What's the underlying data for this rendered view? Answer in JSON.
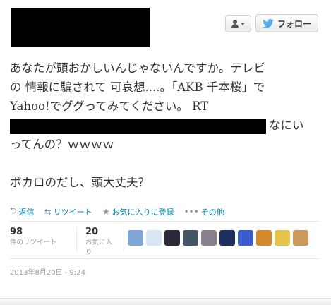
{
  "header": {
    "follow_label": "フォロー",
    "user_menu_icon": "user-icon"
  },
  "tweet": {
    "lines": [
      "あなたが頭おかしいんじゃないんですか。テレビ",
      "の 情報に騙されて 可哀想....。「AKB 千本桜」で",
      "Yahoo!でググってみてください。 RT"
    ],
    "line4_after_redaction": "なにい",
    "line5": "ってんの？ｗｗｗｗ",
    "line7": "ボカロのだし、頭大丈夫？"
  },
  "actions": {
    "reply": "返信",
    "retweet": "リツイート",
    "favorite": "お気に入りに登録",
    "more": "その他"
  },
  "stats": {
    "retweet_count": "98",
    "retweet_label": "件のリツイート",
    "favorite_count": "20",
    "favorite_label": "お気に入り"
  },
  "avatars": [
    {
      "name": "avatar-1",
      "color": "#7fa6d6"
    },
    {
      "name": "avatar-2",
      "color": "#d7e6f2"
    },
    {
      "name": "avatar-3",
      "color": "#2a2a3a"
    },
    {
      "name": "avatar-4",
      "color": "#445566"
    },
    {
      "name": "avatar-5",
      "color": "#8a7f8c"
    },
    {
      "name": "avatar-6",
      "color": "#1f2f5f"
    },
    {
      "name": "avatar-7",
      "color": "#3b5ccf"
    },
    {
      "name": "avatar-8",
      "color": "#d48a2c"
    },
    {
      "name": "avatar-9",
      "color": "#e3c34a"
    },
    {
      "name": "avatar-10",
      "color": "#c99a5b"
    }
  ],
  "timestamp": "2013年8月20日 - 9:24",
  "colors": {
    "link": "#0084b4",
    "muted": "#999999",
    "twitter_blue": "#55acee"
  }
}
